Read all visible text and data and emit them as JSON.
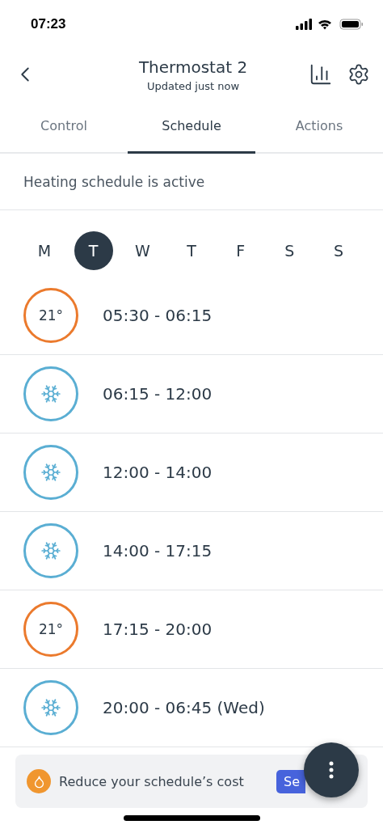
{
  "status_bar": {
    "time": "07:23"
  },
  "header": {
    "title": "Thermostat 2",
    "subtitle": "Updated just now"
  },
  "tabs": [
    {
      "label": "Control",
      "selected": false
    },
    {
      "label": "Schedule",
      "selected": true
    },
    {
      "label": "Actions",
      "selected": false
    }
  ],
  "schedule_status": "Heating schedule is active",
  "days": [
    {
      "label": "M",
      "selected": false
    },
    {
      "label": "T",
      "selected": true
    },
    {
      "label": "W",
      "selected": false
    },
    {
      "label": "T",
      "selected": false
    },
    {
      "label": "F",
      "selected": false
    },
    {
      "label": "S",
      "selected": false
    },
    {
      "label": "S",
      "selected": false
    }
  ],
  "slots": [
    {
      "kind": "heat",
      "temperature": "21°",
      "time": "05:30 - 06:15"
    },
    {
      "kind": "eco",
      "time": "06:15 - 12:00"
    },
    {
      "kind": "eco",
      "time": "12:00 - 14:00"
    },
    {
      "kind": "eco",
      "time": "14:00 - 17:15"
    },
    {
      "kind": "heat",
      "temperature": "21°",
      "time": "17:15 - 20:00"
    },
    {
      "kind": "eco",
      "time": "20:00 - 06:45 (Wed)"
    }
  ],
  "promo": {
    "text": "Reduce your schedule’s cost",
    "button": "Se"
  }
}
